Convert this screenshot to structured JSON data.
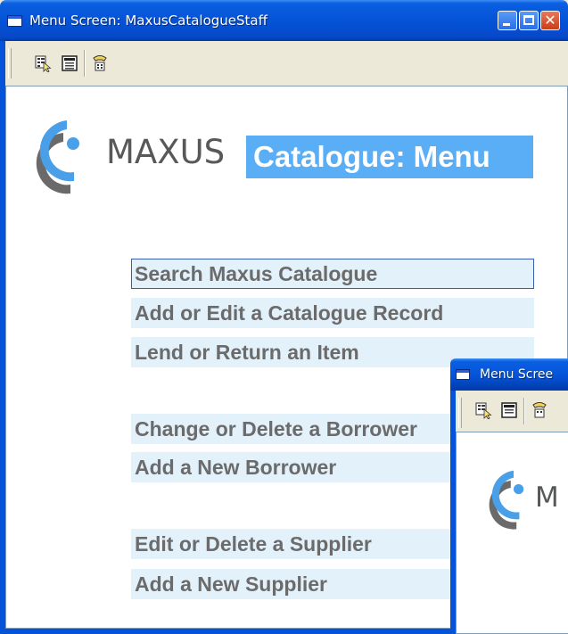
{
  "window": {
    "title": "Menu Screen: MaxusCatalogueStaff",
    "caption_buttons": [
      "minimize-icon",
      "maximize-icon",
      "close-icon"
    ]
  },
  "toolbar": {
    "icons": [
      "select-record-icon",
      "form-view-icon",
      "help-phone-icon"
    ]
  },
  "brand": {
    "name": "MAXUS",
    "heading": "Catalogue: Menu",
    "heading_bg": "#5aaef5",
    "logo_color": "#4aa0e8"
  },
  "menu": {
    "items": [
      "Search Maxus Catalogue",
      "Add or Edit a Catalogue Record",
      "Lend or Return an Item",
      "Change or Delete a Borrower",
      "Add a New Borrower",
      "Edit or Delete a Supplier",
      "Add a New Supplier"
    ],
    "focused_index": 0,
    "item_bg": "#e3f1fb"
  },
  "second_window": {
    "title": "Menu Scree",
    "brand_partial": "M"
  }
}
